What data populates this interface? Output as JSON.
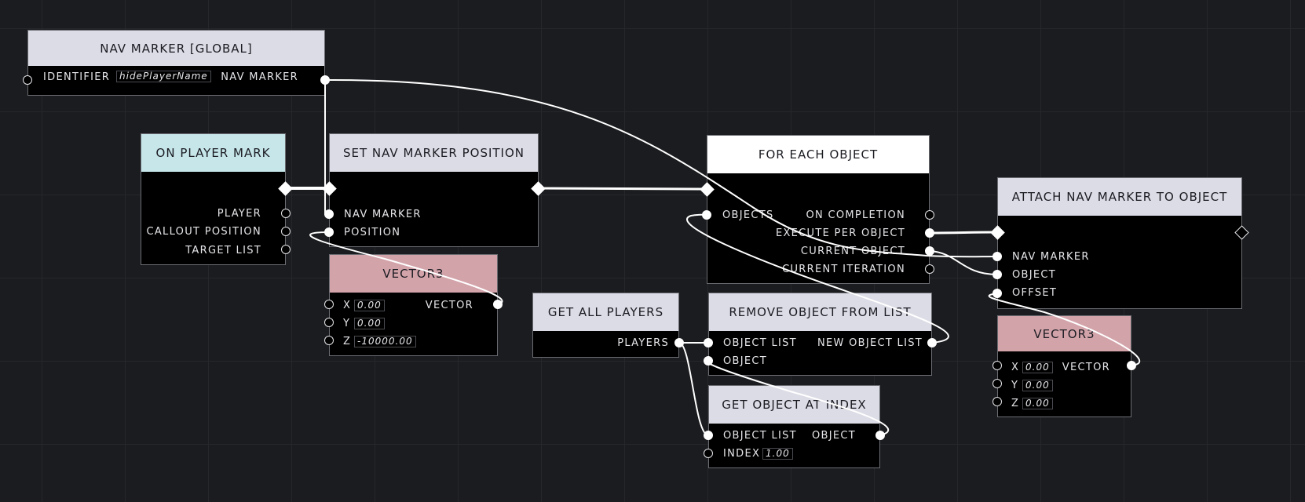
{
  "colors": {
    "background": "#1b1c1f",
    "node_body": "#000000",
    "header_light": "#dcdce6",
    "header_white": "#ffffff",
    "header_event": "#c6e6ea",
    "header_vector": "#d3a3aa",
    "wire": "#ffffff"
  },
  "nodes": {
    "nav_marker_global": {
      "title": "NAV MARKER [GLOBAL]",
      "identifier_label": "IDENTIFIER",
      "identifier_value": "hidePlayerName",
      "nav_marker_label": "NAV MARKER"
    },
    "on_player_mark": {
      "title": "ON PLAYER MARK",
      "outputs": [
        "PLAYER",
        "CALLOUT POSITION",
        "TARGET LIST"
      ]
    },
    "set_nav_marker_position": {
      "title": "SET NAV MARKER POSITION",
      "inputs": [
        "NAV MARKER",
        "POSITION"
      ]
    },
    "vector3_a": {
      "title": "VECTOR3",
      "x_label": "X",
      "x_value": "0.00",
      "y_label": "Y",
      "y_value": "0.00",
      "z_label": "Z",
      "z_value": "-10000.00",
      "output": "VECTOR"
    },
    "for_each_object": {
      "title": "FOR EACH OBJECT",
      "input": "OBJECTS",
      "outputs": [
        "ON COMPLETION",
        "EXECUTE PER OBJECT",
        "CURRENT OBJECT",
        "CURRENT ITERATION"
      ]
    },
    "attach_nav_marker": {
      "title": "ATTACH NAV MARKER TO OBJECT",
      "inputs": [
        "NAV MARKER",
        "OBJECT",
        "OFFSET"
      ]
    },
    "get_all_players": {
      "title": "GET ALL PLAYERS",
      "output": "PLAYERS"
    },
    "remove_object_from_list": {
      "title": "REMOVE OBJECT FROM LIST",
      "inputs": [
        "OBJECT LIST",
        "OBJECT"
      ],
      "output": "NEW OBJECT LIST"
    },
    "get_object_at_index": {
      "title": "GET OBJECT AT INDEX",
      "list_label": "OBJECT LIST",
      "index_label": "INDEX",
      "index_value": "1.00",
      "output": "OBJECT"
    },
    "vector3_b": {
      "title": "VECTOR3",
      "x_label": "X",
      "x_value": "0.00",
      "y_label": "Y",
      "y_value": "0.00",
      "z_label": "Z",
      "z_value": "0.00",
      "output": "VECTOR"
    }
  }
}
